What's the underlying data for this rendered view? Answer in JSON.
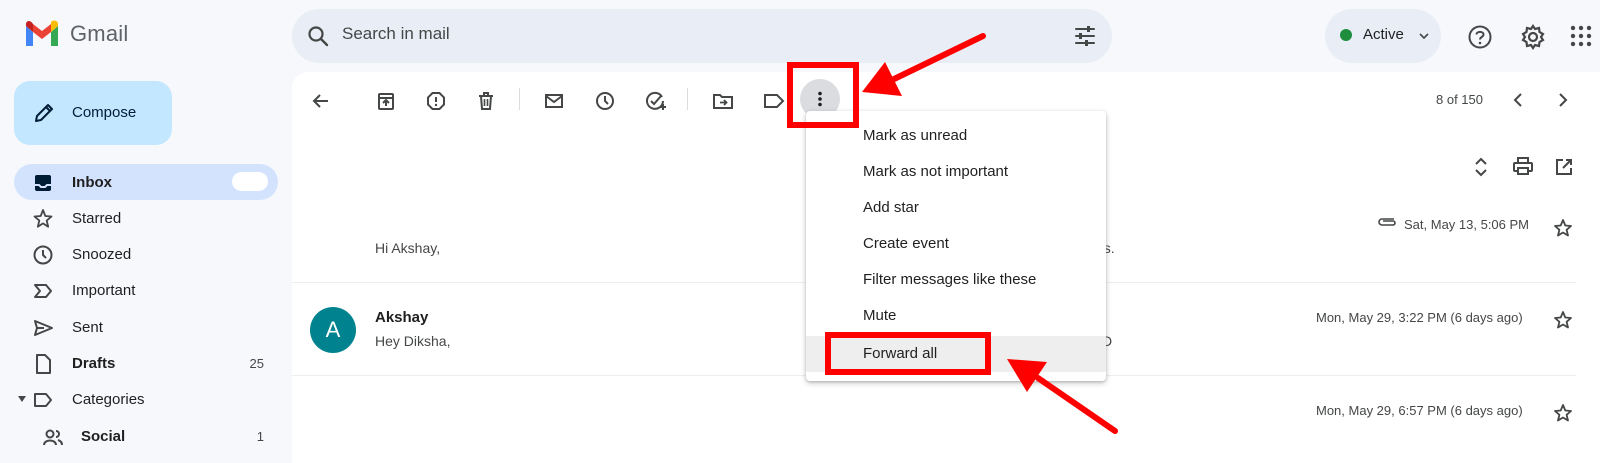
{
  "app": {
    "name": "Gmail"
  },
  "search": {
    "placeholder": "Search in mail"
  },
  "status": {
    "label": "Active",
    "color": "#1e8e3e"
  },
  "sidebar": {
    "compose_label": "Compose",
    "items": [
      {
        "label": "Inbox",
        "count": "",
        "active": true,
        "bold": true,
        "icon": "inbox-icon"
      },
      {
        "label": "Starred",
        "count": "",
        "icon": "star-icon"
      },
      {
        "label": "Snoozed",
        "count": "",
        "icon": "clock-icon"
      },
      {
        "label": "Important",
        "count": "",
        "icon": "important-icon"
      },
      {
        "label": "Sent",
        "count": "",
        "icon": "send-icon"
      },
      {
        "label": "Drafts",
        "count": "25",
        "bold": true,
        "icon": "draft-icon"
      },
      {
        "label": "Categories",
        "count": "",
        "icon": "label-icon"
      },
      {
        "label": "Social",
        "count": "1",
        "bold": true,
        "icon": "people-icon"
      }
    ]
  },
  "toolbar": {
    "counter": "8 of 150"
  },
  "thread": [
    {
      "sender": "",
      "snippet": "Hi Akshay,",
      "snippet_tail": "es.",
      "date": "Sat, May 13, 5:06 PM",
      "has_attachment": true
    },
    {
      "sender": "Akshay",
      "avatar_letter": "A",
      "snippet": "Hey Diksha,",
      "snippet_tail": "D",
      "date": "Mon, May 29, 3:22 PM (6 days ago)"
    },
    {
      "sender": "",
      "snippet": "",
      "date": "Mon, May 29, 6:57 PM (6 days ago)"
    }
  ],
  "menu": {
    "items": [
      "Mark as unread",
      "Mark as not important",
      "Add star",
      "Create event",
      "Filter messages like these",
      "Mute",
      "Forward all"
    ],
    "highlighted": "Forward all"
  },
  "annotation_color": "#ff0000"
}
